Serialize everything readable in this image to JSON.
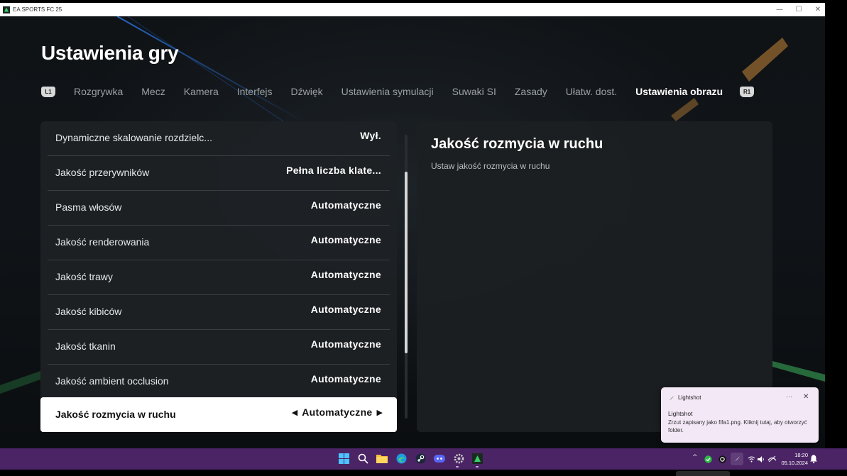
{
  "window": {
    "title": "EA SPORTS FC 25",
    "controls": {
      "minimize": "—",
      "maximize": "☐",
      "close": "✕"
    }
  },
  "page_title": "Ustawienia gry",
  "tabs": {
    "left_bumper": "L1",
    "right_bumper": "R1",
    "items": [
      {
        "label": "Rozgrywka",
        "active": false
      },
      {
        "label": "Mecz",
        "active": false
      },
      {
        "label": "Kamera",
        "active": false
      },
      {
        "label": "Interfejs",
        "active": false
      },
      {
        "label": "Dźwięk",
        "active": false
      },
      {
        "label": "Ustawienia symulacji",
        "active": false
      },
      {
        "label": "Suwaki SI",
        "active": false
      },
      {
        "label": "Zasady",
        "active": false
      },
      {
        "label": "Ułatw. dost.",
        "active": false
      },
      {
        "label": "Ustawienia obrazu",
        "active": true
      }
    ]
  },
  "settings": [
    {
      "label": "Dynamiczne skalowanie rozdzielc...",
      "value": "Wył."
    },
    {
      "label": "Jakość przerywników",
      "value": "Pełna liczba klate..."
    },
    {
      "label": "Pasma włosów",
      "value": "Automatyczne"
    },
    {
      "label": "Jakość renderowania",
      "value": "Automatyczne"
    },
    {
      "label": "Jakość trawy",
      "value": "Automatyczne"
    },
    {
      "label": "Jakość kibiców",
      "value": "Automatyczne"
    },
    {
      "label": "Jakość tkanin",
      "value": "Automatyczne"
    },
    {
      "label": "Jakość ambient occlusion",
      "value": "Automatyczne"
    }
  ],
  "selected_setting": {
    "label": "Jakość rozmycia w ruchu",
    "value": "Automatyczne",
    "prev_arrow": "◀",
    "next_arrow": "▶"
  },
  "scroll_position": 0.36,
  "detail": {
    "title": "Jakość rozmycia w ruchu",
    "description": "Ustaw jakość rozmycia w ruchu"
  },
  "notification": {
    "app": "Lightshot",
    "more": "···",
    "close": "✕",
    "title": "Lightshot",
    "body": "Zrzut zapisany jako fifa1.png. Kliknij tutaj, aby otworzyć folder."
  },
  "taskbar": {
    "apps": [
      "windows-start",
      "search",
      "file-explorer",
      "edge",
      "steam",
      "discord",
      "settings",
      "ea-sports-fc"
    ],
    "tray_chevron": "^",
    "time": "18:20",
    "date": "05.10.2024"
  },
  "colors": {
    "accent_taskbar": "#4b2466",
    "selected_row": "#ffffff",
    "panel": "#1e2124",
    "pitch_line": "#2a6fd6",
    "stadium_light": "#f0a040"
  }
}
